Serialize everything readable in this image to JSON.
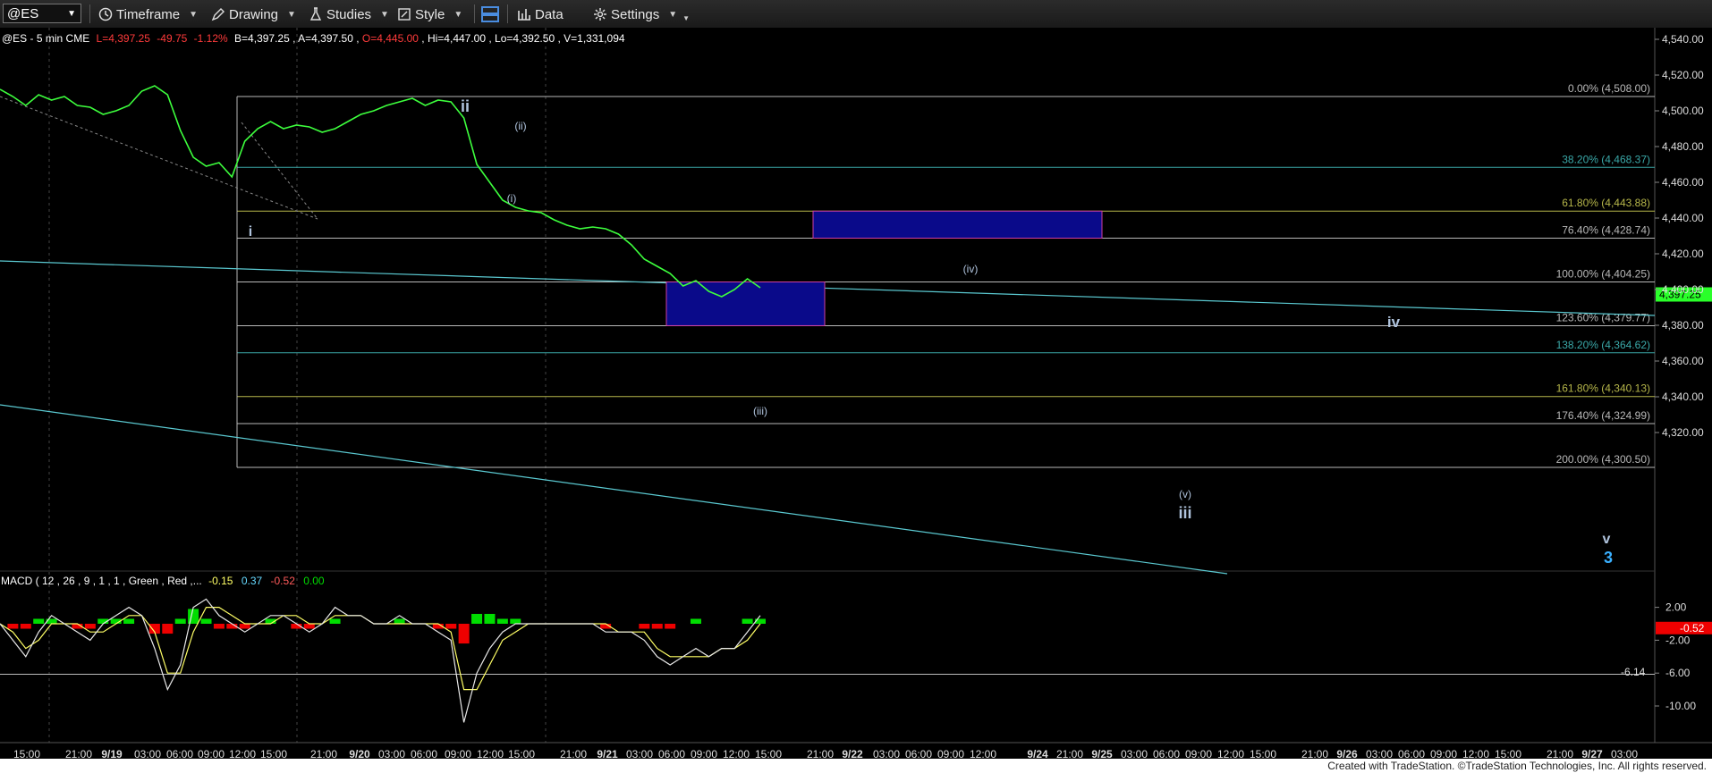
{
  "toolbar": {
    "symbol": "@ES",
    "timeframe_label": "Timeframe",
    "drawing_label": "Drawing",
    "studies_label": "Studies",
    "style_label": "Style",
    "data_label": "Data",
    "settings_label": "Settings"
  },
  "header": {
    "symbol_info": "@ES - 5 min  CME",
    "last": "L=4,397.25",
    "change": "-49.75",
    "change_pct": "-1.12%",
    "bid": "B=4,397.25",
    "ask": "A=4,397.50",
    "open": "O=4,445.00",
    "high": "Hi=4,447.00",
    "low": "Lo=4,392.50",
    "volume": "V=1,331,094"
  },
  "macd": {
    "label": "MACD ( 12 , 26 , 9 , 1 , 1 , Green , Red ,...",
    "v1": "-0.15",
    "v2": "0.37",
    "v3": "-0.52",
    "v4": "0.00",
    "level_label": "-6.14"
  },
  "footer": {
    "credit": "Created with TradeStation. ©TradeStation Technologies, Inc. All rights reserved."
  },
  "colors": {
    "price": "#3dff3d",
    "fib_gray": "#b8b8b8",
    "fib_teal": "#3aa8a8",
    "fib_olive": "#b6b64a",
    "trendline": "#5ac8d0",
    "target_box": "#0a0a8a",
    "macd_line": "#e8e8e8",
    "signal_line": "#ffff66",
    "hist_pos": "#00dd00",
    "hist_neg": "#ee0000",
    "wave_label": "#b0c4de"
  },
  "chart_data": {
    "type": "line",
    "title": "",
    "xlabel": "",
    "ylabel": "",
    "ylim": [
      4290,
      4545
    ],
    "y_ticks": [
      "4,540.00",
      "4,520.00",
      "4,500.00",
      "4,480.00",
      "4,460.00",
      "4,440.00",
      "4,420.00",
      "4,400.00",
      "4,380.00",
      "4,360.00",
      "4,340.00",
      "4,320.00"
    ],
    "x_ticks": [
      "15:00",
      "21:00",
      "9/19",
      "03:00",
      "06:00",
      "09:00",
      "12:00",
      "15:00",
      "21:00",
      "9/20",
      "03:00",
      "06:00",
      "09:00",
      "12:00",
      "15:00",
      "21:00",
      "9/21",
      "03:00",
      "06:00",
      "09:00",
      "12:00",
      "15:00",
      "21:00",
      "9/22",
      "03:00",
      "06:00",
      "09:00",
      "12:00",
      "9/24",
      "21:00",
      "9/25",
      "03:00",
      "06:00",
      "09:00",
      "12:00",
      "15:00",
      "21:00",
      "9/26",
      "03:00",
      "06:00",
      "09:00",
      "12:00",
      "15:00",
      "21:00",
      "9/27",
      "03:00"
    ],
    "last_price_label": "4,397.25",
    "series": [
      {
        "values": [
          4512,
          4508,
          4503,
          4509,
          4506,
          4508,
          4503,
          4502,
          4498,
          4500,
          4503,
          4511,
          4514,
          4509,
          4489,
          4474,
          4469,
          4471,
          4463,
          4483,
          4490,
          4494,
          4490,
          4492,
          4491,
          4488,
          4490,
          4494,
          4498,
          4500,
          4503,
          4505,
          4507,
          4503,
          4506,
          4505,
          4496,
          4470,
          4460,
          4450,
          4446,
          4444,
          4443,
          4439,
          4436,
          4434,
          4435,
          4434,
          4431,
          4425,
          4417,
          4413,
          4409,
          4402,
          4405,
          4399,
          4396,
          4400,
          4406,
          4401
        ]
      }
    ],
    "fib_levels": [
      {
        "label": "0.00% (4,508.00)",
        "value": 4508.0
      },
      {
        "label": "38.20% (4,468.37)",
        "value": 4468.37
      },
      {
        "label": "61.80% (4,443.88)",
        "value": 4443.88
      },
      {
        "label": "76.40% (4,428.74)",
        "value": 4428.74
      },
      {
        "label": "100.00% (4,404.25)",
        "value": 4404.25
      },
      {
        "label": "123.60% (4,379.77)",
        "value": 4379.77
      },
      {
        "label": "138.20% (4,364.62)",
        "value": 4364.62
      },
      {
        "label": "161.80% (4,340.13)",
        "value": 4340.13
      },
      {
        "label": "176.40% (4,324.99)",
        "value": 4324.99
      },
      {
        "label": "200.00% (4,300.50)",
        "value": 4300.5
      }
    ],
    "target_boxes": [
      {
        "label": "(iv)",
        "from": 4428.74,
        "to": 4443.88
      },
      {
        "label": "(iii)",
        "from": 4379.77,
        "to": 4404.25
      }
    ],
    "wave_labels": [
      "i",
      "ii",
      "(i)",
      "(ii)",
      "(iii)",
      "(iv)",
      "iv",
      "(v)",
      "iii",
      "v",
      "3"
    ],
    "macd_ticks": [
      "2.00",
      "-2.00",
      "-6.00",
      "-10.00"
    ],
    "macd_last": "-0.52",
    "macd_line": [
      0,
      -2,
      -4,
      -1,
      1,
      0,
      -1,
      -2,
      0,
      1,
      2,
      1,
      -3,
      -8,
      -5,
      2,
      3,
      1,
      0,
      -1,
      0,
      1,
      1,
      0,
      -1,
      0,
      2,
      1,
      1,
      0,
      0,
      1,
      0,
      0,
      -1,
      -2,
      -12,
      -6,
      -3,
      -1,
      0,
      0,
      0,
      0,
      0,
      0,
      0,
      -1,
      -1,
      -1,
      -2,
      -4,
      -5,
      -4,
      -3,
      -4,
      -3,
      -3,
      -1,
      1
    ],
    "signal_line": [
      0,
      -1,
      -3,
      -2,
      0,
      0,
      0,
      -1,
      -1,
      0,
      1,
      1,
      -1,
      -6,
      -6,
      -1,
      2,
      2,
      1,
      0,
      0,
      0,
      1,
      1,
      0,
      0,
      1,
      1,
      1,
      0,
      0,
      0,
      0,
      0,
      0,
      -1,
      -8,
      -8,
      -5,
      -2,
      -1,
      0,
      0,
      0,
      0,
      0,
      0,
      0,
      -1,
      -1,
      -1,
      -3,
      -4,
      -4,
      -4,
      -4,
      -3,
      -3,
      -2,
      0
    ]
  }
}
